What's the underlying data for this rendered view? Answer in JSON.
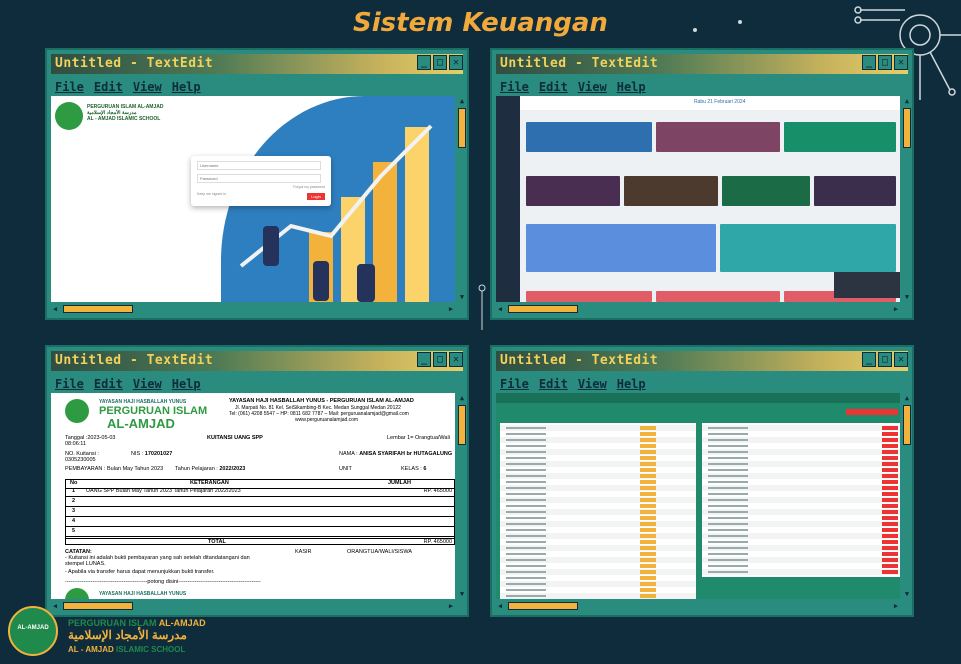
{
  "page": {
    "title": "Sistem Keuangan"
  },
  "window": {
    "title": "Untitled - TextEdit",
    "menu": {
      "file": "File",
      "edit": "Edit",
      "view": "View",
      "help": "Help"
    }
  },
  "login": {
    "brand_line1": "PERGURUAN ISLAM AL-AMJAD",
    "brand_line2": "مدرسة الأمجاد الإسلامية",
    "brand_line3": "AL - AMJAD ISLAMIC SCHOOL",
    "username_placeholder": "Username",
    "password_placeholder": "Password",
    "remember": "Keep me signed in",
    "forgot": "Forgot my password",
    "login_button": "Login"
  },
  "dashboard": {
    "header_date": "Rabu 21 Februari 2024"
  },
  "receipt": {
    "foundation": "YAYASAN HAJI HASBALLAH YUNUS",
    "school": "PERGURUAN ISLAM",
    "school_name": "AL-AMJAD",
    "header_title": "YAYASAN HAJI HASBALLAH YUNUS - PERGURUAN ISLAM AL-AMJAD",
    "address": "Jl. Marpati No. 81 Kel. SeiSikambing-B Kec. Medan Sunggal Medan 20122",
    "contact": "Tel: (061) 4208 5547 – HP: 0811 682 7787 – Mail: perguruanalamjad@gmail.com",
    "website": "www.perguruanalamjad.com",
    "date": "Tanggal :2023-05-03 08:06:11",
    "doc_title": "KUITANSI UANG SPP",
    "sheet": "Lembar 1= Orangtua/Wali",
    "receipt_no": "NO. Kuitansi : 0305230005",
    "nis_label": "NIS :",
    "nis": "170201027",
    "name_label": "NAMA :",
    "name": "ANISA SYARIFAH br HUTAGALUNG",
    "payment": "PEMBAYARAN : Bulan May Tahun 2023",
    "year_label": "Tahun Pelajaran :",
    "year": "2022/2023",
    "unit": "UNIT",
    "class_label": "KELAS :",
    "class": "6",
    "col_no": "No",
    "col_desc": "KETERANGAN",
    "col_amount": "JUMLAH",
    "rows": [
      {
        "no": "1",
        "desc": "UANG SPP Bulan May Tahun 2023 Tahun Pelajaran 2022/2023",
        "amount": "RP. 465000"
      },
      {
        "no": "2",
        "desc": "",
        "amount": ""
      },
      {
        "no": "3",
        "desc": "",
        "amount": ""
      },
      {
        "no": "4",
        "desc": "",
        "amount": ""
      },
      {
        "no": "5",
        "desc": "",
        "amount": ""
      }
    ],
    "total_label": "TOTAL",
    "total": "RP. 465000",
    "notes_title": "CATATAN:",
    "note1": "- Kuitansi ini adalah bukti pembayaran yang sah setelah ditandatangani dan stempel LUNAS.",
    "note2": "- Apabila via transfer harus dapat menunjukkan bukti transfer.",
    "cashier": "KASIR",
    "guardian": "ORANGTUA/WALI/SISWA",
    "cut": "---------------------------------------------potong disini---------------------------------------------"
  },
  "footer": {
    "logo_text": "AL-AMJAD",
    "line1a": "PERGURUAN ISLAM",
    "line1b": "AL-AMJAD",
    "line2": "مدرسة الأمجاد الإسلامية",
    "line3a": "AL - AMJAD",
    "line3b": "ISLAMIC SCHOOL"
  },
  "colors": {
    "background": "#0f2c3c",
    "accent": "#f2a93b",
    "window": "#2a8c7e"
  }
}
